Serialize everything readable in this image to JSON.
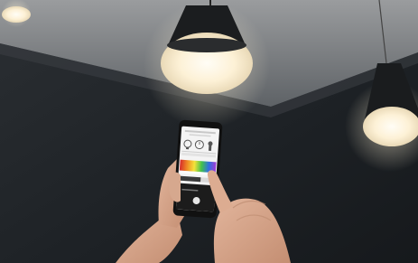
{
  "scene": {
    "description_tag": "photo-smart-lighting-phone",
    "icons": [
      "bulb-icon",
      "timer-icon",
      "sensor-icon"
    ],
    "colors": {
      "wall": "#1e2226",
      "ceiling": "#8c8f92",
      "lamp_shade": "#1a1c1e",
      "lamp_glow": "#fff6e4",
      "skin": "#d7a78d"
    }
  }
}
